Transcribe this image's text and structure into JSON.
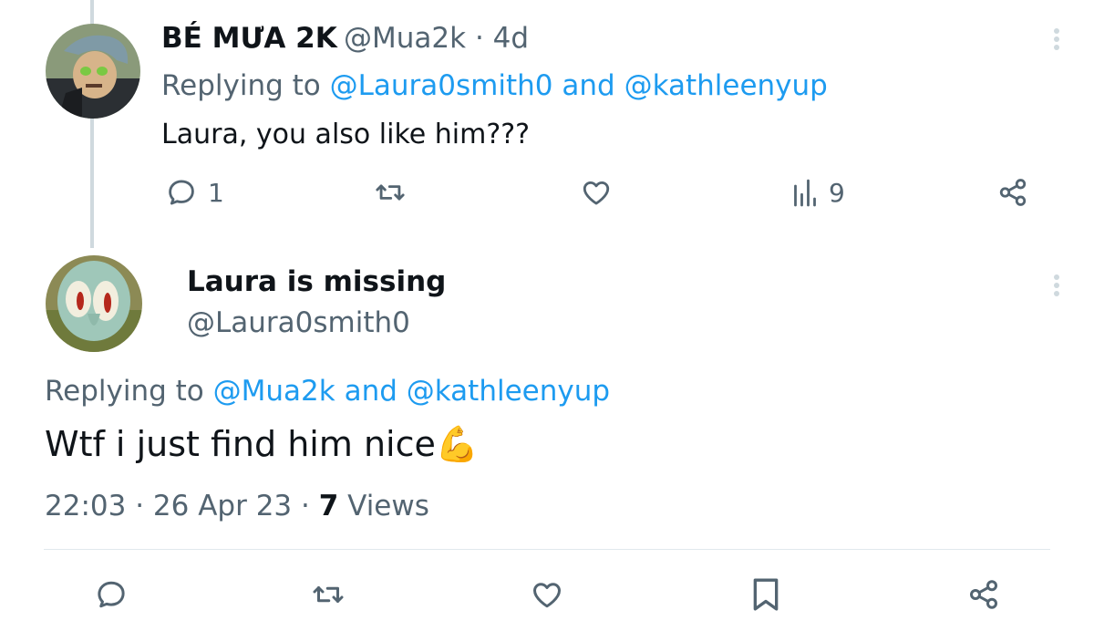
{
  "tweet1": {
    "display_name": "BÉ MƯA 2K",
    "handle": "@Mua2k",
    "separator": "·",
    "age": "4d",
    "replying_prefix": "Replying to",
    "reply_to_1": "@Laura0smith0",
    "reply_and": "and",
    "reply_to_2": "@kathleenyup",
    "text": "Laura, you also like him???",
    "reply_count": "1",
    "view_count": "9"
  },
  "tweet2": {
    "display_name": "Laura is missing",
    "handle": "@Laura0smith0",
    "replying_prefix": "Replying to",
    "reply_to_1": "@Mua2k",
    "reply_and": "and",
    "reply_to_2": "@kathleenyup",
    "text": "Wtf i just find him nice",
    "emoji": "💪",
    "time": "22:03",
    "dot": "·",
    "date": "26 Apr 23",
    "views_count": "7",
    "views_label": "Views"
  },
  "colors": {
    "accent": "#1d9bf0",
    "muted": "#536471",
    "text": "#0f1419",
    "thread_line": "#cfd9de"
  },
  "icons": {
    "reply": "reply-icon",
    "retweet": "retweet-icon",
    "like": "heart-icon",
    "views": "views-icon",
    "share": "share-icon",
    "bookmark": "bookmark-icon",
    "more": "more-icon"
  }
}
